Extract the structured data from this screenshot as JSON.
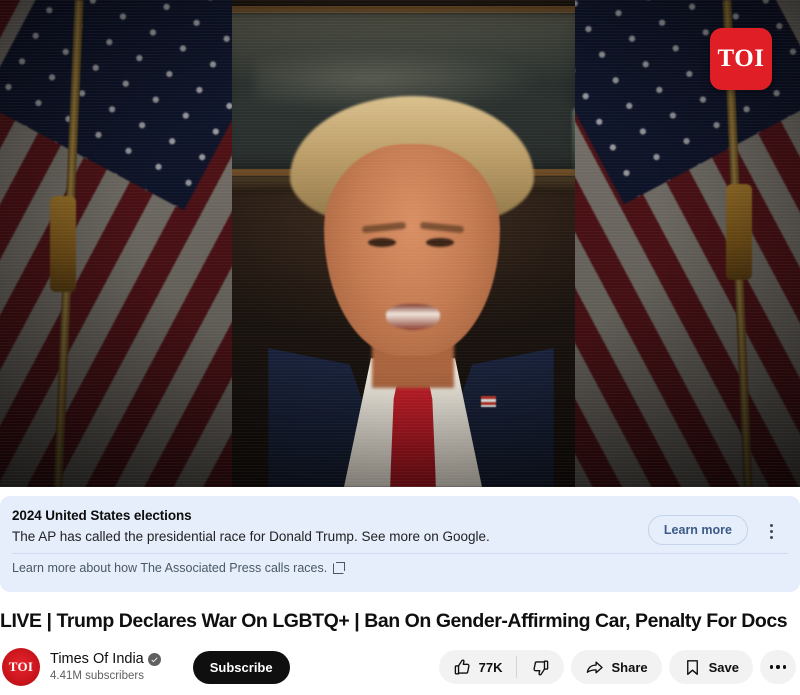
{
  "player": {
    "watermark_text": "TOI",
    "scene_description": "Donald Trump speaking between two United States flags"
  },
  "info_panel": {
    "title": "2024 United States elections",
    "description": "The AP has called the presidential race for Donald Trump. See more on Google.",
    "learn_more_label": "Learn more",
    "footer_text": "Learn more about how The Associated Press calls races.",
    "background_color": "#e6eefb",
    "link_color": "#3c5a86"
  },
  "video": {
    "title": "LIVE | Trump Declares War On LGBTQ+ | Ban On Gender-Affirming Car, Penalty For Docs"
  },
  "channel": {
    "avatar_text": "TOI",
    "name": "Times Of India",
    "subscribers": "4.41M subscribers",
    "subscribe_label": "Subscribe",
    "brand_color": "#c4121a"
  },
  "actions": {
    "like_count": "77K",
    "share_label": "Share",
    "save_label": "Save"
  }
}
